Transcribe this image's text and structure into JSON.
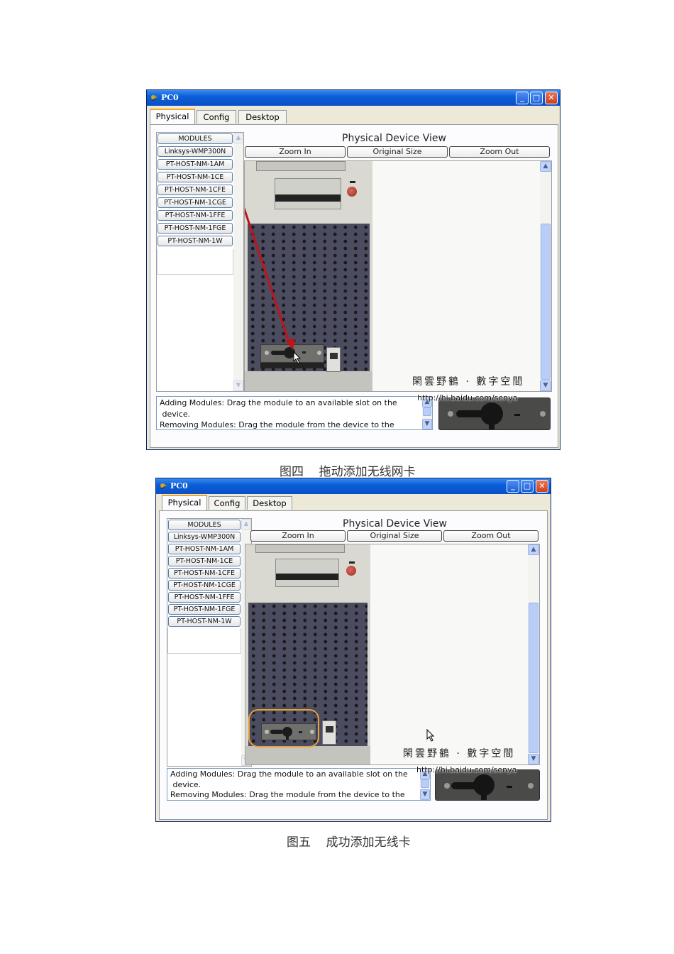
{
  "figures": [
    {
      "window": {
        "title": "PC0",
        "tabs": [
          {
            "label": "Physical",
            "active": true
          },
          {
            "label": "Config",
            "active": false
          },
          {
            "label": "Desktop",
            "active": false
          }
        ],
        "controls": {
          "minimize": "_",
          "maximize": "□",
          "close": "✕"
        },
        "modules_header": "MODULES",
        "modules": [
          "Linksys-WMP300N",
          "PT-HOST-NM-1AM",
          "PT-HOST-NM-1CE",
          "PT-HOST-NM-1CFE",
          "PT-HOST-NM-1CGE",
          "PT-HOST-NM-1FFE",
          "PT-HOST-NM-1FGE",
          "PT-HOST-NM-1W"
        ],
        "view_title": "Physical Device View",
        "zoom_buttons": {
          "zoom_in": "Zoom In",
          "original_size": "Original Size",
          "zoom_out": "Zoom Out"
        },
        "watermark": "閑雲野鶴 · 數字空間",
        "info_text": "Adding Modules: Drag the module to an available slot on the\n device.\nRemoving Modules: Drag the module from the device to the",
        "url_overlay": "http://hi.baidu.com/senya",
        "state": "dragging",
        "arrow_color": "#c0141b"
      },
      "caption": "图四    拖动添加无线网卡"
    },
    {
      "window": {
        "title": "PC0",
        "tabs": [
          {
            "label": "Physical",
            "active": true
          },
          {
            "label": "Config",
            "active": false
          },
          {
            "label": "Desktop",
            "active": false
          }
        ],
        "controls": {
          "minimize": "_",
          "maximize": "□",
          "close": "✕"
        },
        "modules_header": "MODULES",
        "modules": [
          "Linksys-WMP300N",
          "PT-HOST-NM-1AM",
          "PT-HOST-NM-1CE",
          "PT-HOST-NM-1CFE",
          "PT-HOST-NM-1CGE",
          "PT-HOST-NM-1FFE",
          "PT-HOST-NM-1FGE",
          "PT-HOST-NM-1W"
        ],
        "view_title": "Physical Device View",
        "zoom_buttons": {
          "zoom_in": "Zoom In",
          "original_size": "Original Size",
          "zoom_out": "Zoom Out"
        },
        "watermark": "閑雲野鶴 · 數字空間",
        "info_text": "Adding Modules: Drag the module to an available slot on the\n device.\nRemoving Modules: Drag the module from the device to the",
        "url_overlay": "http://hi.baidu.com/senya",
        "state": "installed",
        "highlight_color": "#e8a23a"
      },
      "caption": "图五    成功添加无线卡"
    }
  ]
}
